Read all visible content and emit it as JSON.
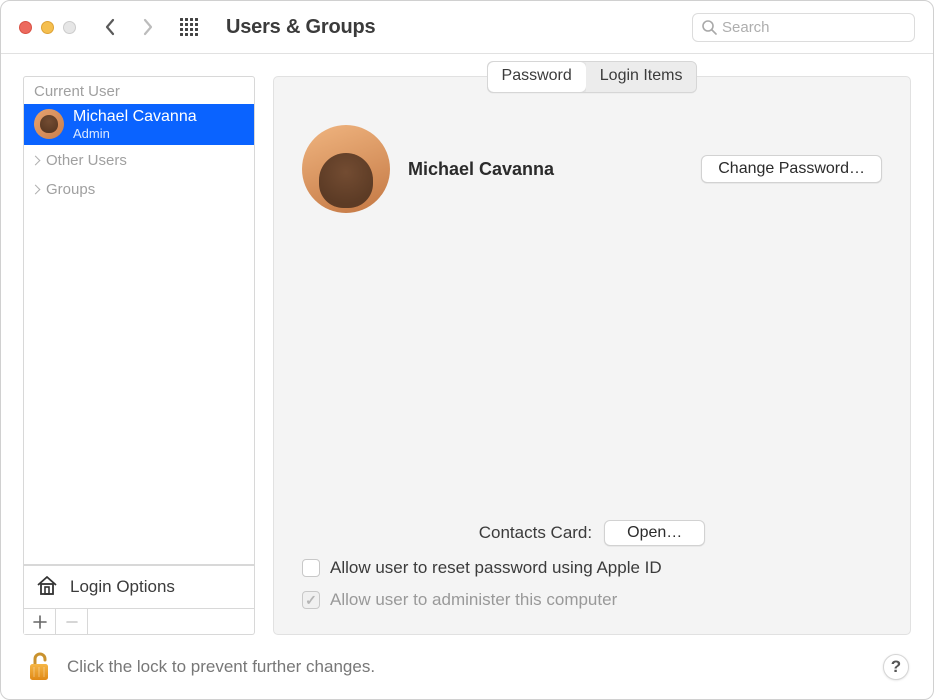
{
  "titlebar": {
    "title": "Users & Groups",
    "search_placeholder": "Search"
  },
  "sidebar": {
    "current_header": "Current User",
    "user": {
      "name": "Michael Cavanna",
      "role": "Admin"
    },
    "other_users_label": "Other Users",
    "groups_label": "Groups",
    "login_options_label": "Login Options"
  },
  "tabs": {
    "password": "Password",
    "login_items": "Login Items"
  },
  "detail": {
    "user_name": "Michael Cavanna",
    "change_password": "Change Password…",
    "contacts_card_label": "Contacts Card:",
    "open_button": "Open…",
    "allow_reset": "Allow user to reset password using Apple ID",
    "allow_admin": "Allow user to administer this computer"
  },
  "footer": {
    "lock_message": "Click the lock to prevent further changes."
  }
}
